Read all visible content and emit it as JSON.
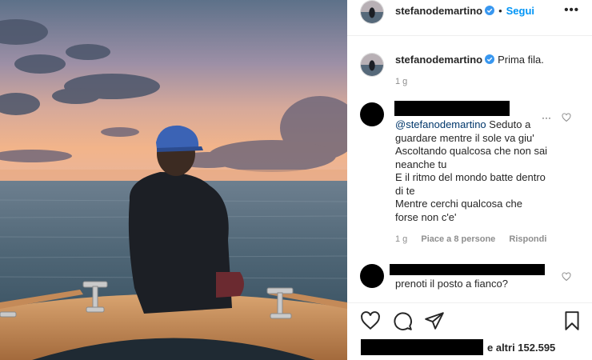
{
  "post": {
    "author": "stefanodemartino",
    "follow_label": "Segui",
    "separator": "•",
    "more_glyph": "•••"
  },
  "caption": {
    "author": "stefanodemartino",
    "text": "Prima fila.",
    "time": "1 g"
  },
  "comments": [
    {
      "mention": "@stefanodemartino",
      "lines": [
        " Seduto a",
        "guardare mentre il sole va giu'",
        "Ascoltando qualcosa che non sai",
        "neanche tu",
        "E il ritmo del mondo batte dentro",
        "di te",
        "Mentre cerchi qualcosa che",
        "forse non c'e'"
      ],
      "time": "1 g",
      "likes": "Piace a 8 persone",
      "reply": "Rispondi"
    },
    {
      "text": "prenoti il posto a fianco?"
    }
  ],
  "footer": {
    "likes_suffix": "e altri 152.595"
  },
  "colors": {
    "link_blue": "#0095f6",
    "verified_blue": "#3897f0",
    "meta_grey": "#8e8e8e"
  },
  "icons": [
    "verified-badge-icon",
    "heart-icon",
    "comment-icon",
    "share-icon",
    "bookmark-icon",
    "more-icon"
  ]
}
